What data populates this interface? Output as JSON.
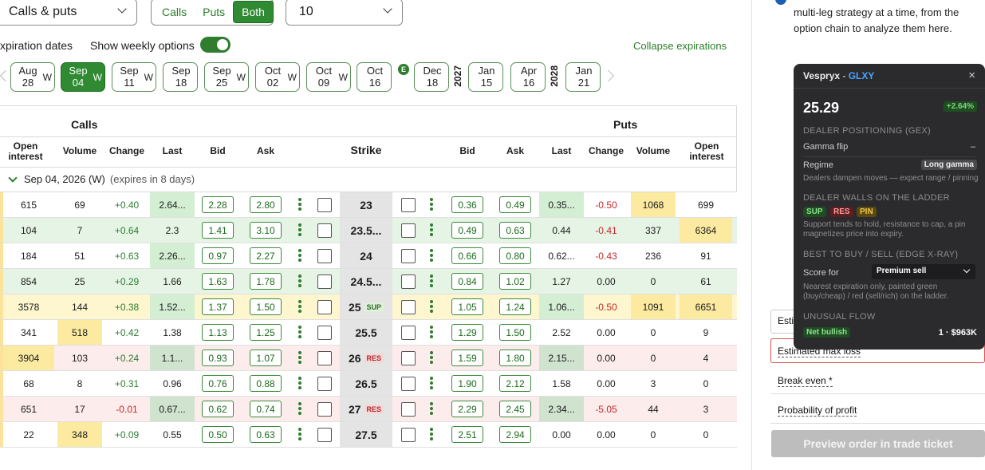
{
  "top": {
    "type_select": "Calls & puts",
    "seg_options": [
      "Calls",
      "Puts",
      "Both"
    ],
    "strikes_select": "10"
  },
  "bar": {
    "expiration_label": "xpiration dates",
    "weekly_label": "Show weekly options",
    "collapse_label": "Collapse expirations"
  },
  "expirations": [
    {
      "m": "Aug",
      "d": "28",
      "w": "W"
    },
    {
      "m": "Sep",
      "d": "04",
      "w": "W",
      "active": true
    },
    {
      "m": "Sep",
      "d": "11",
      "w": "W"
    },
    {
      "m": "Sep",
      "d": "18",
      "w": ""
    },
    {
      "m": "Sep",
      "d": "25",
      "w": "W"
    },
    {
      "m": "Oct",
      "d": "02",
      "w": "W"
    },
    {
      "m": "Oct",
      "d": "09",
      "w": "W"
    },
    {
      "m": "Oct",
      "d": "16",
      "w": ""
    },
    {
      "m": "Dec",
      "d": "18",
      "w": ""
    },
    {
      "m": "Jan",
      "d": "15",
      "w": ""
    },
    {
      "m": "Apr",
      "d": "16",
      "w": ""
    },
    {
      "m": "Jan",
      "d": "21",
      "w": ""
    }
  ],
  "earnings_badge": "E",
  "years": [
    "2027",
    "2028"
  ],
  "table": {
    "calls_label": "Calls",
    "puts_label": "Puts",
    "call_headers": [
      "Open interest",
      "Volume",
      "Change",
      "Last",
      "Bid",
      "Ask"
    ],
    "strike_header": "Strike",
    "put_headers": [
      "Bid",
      "Ask",
      "Last",
      "Change",
      "Volume",
      "Open interest"
    ],
    "group_label": "Sep 04, 2026 (W)",
    "group_note": "(expires in 8 days)",
    "rows": [
      {
        "coi": "615",
        "cvol": "69",
        "cchg": "+0.40",
        "clast": "2.64...",
        "cbid": "2.28",
        "cask": "2.80",
        "strike": "23",
        "tag": "",
        "pbid": "0.36",
        "pask": "0.49",
        "plast": "0.35...",
        "pchg": "-0.50",
        "pvol": "1068",
        "poi": "699"
      },
      {
        "coi": "104",
        "cvol": "7",
        "cchg": "+0.64",
        "clast": "2.3",
        "cbid": "1.41",
        "cask": "3.10",
        "strike": "23.5...",
        "tag": "",
        "pbid": "0.49",
        "pask": "0.63",
        "plast": "0.44",
        "pchg": "-0.41",
        "pvol": "337",
        "poi": "6364"
      },
      {
        "coi": "184",
        "cvol": "51",
        "cchg": "+0.63",
        "clast": "2.26...",
        "cbid": "0.97",
        "cask": "2.27",
        "strike": "24",
        "tag": "",
        "pbid": "0.66",
        "pask": "0.80",
        "plast": "0.62...",
        "pchg": "-0.43",
        "pvol": "236",
        "poi": "91"
      },
      {
        "coi": "854",
        "cvol": "25",
        "cchg": "+0.29",
        "clast": "1.66",
        "cbid": "1.63",
        "cask": "1.78",
        "strike": "24.5...",
        "tag": "",
        "pbid": "0.84",
        "pask": "1.02",
        "plast": "1.27",
        "pchg": "0.00",
        "pvol": "0",
        "poi": "61"
      },
      {
        "coi": "3578",
        "cvol": "144",
        "cchg": "+0.38",
        "clast": "1.52...",
        "cbid": "1.37",
        "cask": "1.50",
        "strike": "25",
        "tag": "SUP",
        "pbid": "1.05",
        "pask": "1.24",
        "plast": "1.06...",
        "pchg": "-0.50",
        "pvol": "1091",
        "poi": "6651"
      },
      {
        "coi": "341",
        "cvol": "518",
        "cchg": "+0.42",
        "clast": "1.38",
        "cbid": "1.13",
        "cask": "1.25",
        "strike": "25.5",
        "tag": "",
        "pbid": "1.29",
        "pask": "1.50",
        "plast": "2.52",
        "pchg": "0.00",
        "pvol": "0",
        "poi": "9"
      },
      {
        "coi": "3904",
        "cvol": "103",
        "cchg": "+0.24",
        "clast": "1.1...",
        "cbid": "0.93",
        "cask": "1.07",
        "strike": "26",
        "tag": "RES",
        "pbid": "1.59",
        "pask": "1.80",
        "plast": "2.15...",
        "pchg": "0.00",
        "pvol": "0",
        "poi": "4"
      },
      {
        "coi": "68",
        "cvol": "8",
        "cchg": "+0.31",
        "clast": "0.96",
        "cbid": "0.76",
        "cask": "0.88",
        "strike": "26.5",
        "tag": "",
        "pbid": "1.90",
        "pask": "2.12",
        "plast": "1.58",
        "pchg": "0.00",
        "pvol": "3",
        "poi": "0"
      },
      {
        "coi": "651",
        "cvol": "17",
        "cchg": "-0.01",
        "clast": "0.67...",
        "cbid": "0.62",
        "cask": "0.74",
        "strike": "27",
        "tag": "RES",
        "pbid": "2.29",
        "pask": "2.45",
        "plast": "2.34...",
        "pchg": "-5.05",
        "pvol": "44",
        "poi": "3"
      },
      {
        "coi": "22",
        "cvol": "348",
        "cchg": "+0.09",
        "clast": "0.55",
        "cbid": "0.50",
        "cask": "0.63",
        "strike": "27.5",
        "tag": "",
        "pbid": "2.51",
        "pask": "2.94",
        "plast": "0.00",
        "pchg": "0.00",
        "pvol": "0",
        "poi": "0"
      }
    ]
  },
  "side": {
    "info_line1": "multi-leg strategy at a time, from the",
    "info_line2": "option chain to analyze them here.",
    "est_partial": "Esti",
    "est_max_loss": "Estimated max loss",
    "break_even": "Break even *",
    "prob_profit": "Probability of profit",
    "preview_btn": "Preview order in trade ticket"
  },
  "panel": {
    "name": "Vespryx",
    "sep": " - ",
    "ticker": "GLXY",
    "price": "25.29",
    "change": "+2.64%",
    "gex_title": "DEALER POSITIONING (GEX)",
    "gamma_flip": "Gamma flip",
    "gamma_flip_val": "–",
    "regime": "Regime",
    "regime_val": "Long gamma",
    "regime_note": "Dealers dampen moves — expect range / pinning",
    "walls_title": "DEALER WALLS ON THE LADDER",
    "wall_tags": [
      "SUP",
      "RES",
      "PIN"
    ],
    "walls_note1": "Support tends to hold, resistance to cap, a pin",
    "walls_note2": "magnetizes price into expiry.",
    "best_title": "BEST TO BUY / SELL (EDGE X-RAY)",
    "score_for": "Score for",
    "score_val": "Premium sell",
    "best_note1": "Nearest expiration only, painted green",
    "best_note2": "(buy/cheap) / red (sell/rich) on the ladder.",
    "flow_title": "UNUSUAL FLOW",
    "flow_tag": "Net bullish",
    "flow_val": "1 · $963K",
    "close": "×"
  },
  "colors": {
    "accent": "#2f8a32",
    "panel_bg": "#2b2b2e",
    "ticker": "#4aa3ff"
  }
}
